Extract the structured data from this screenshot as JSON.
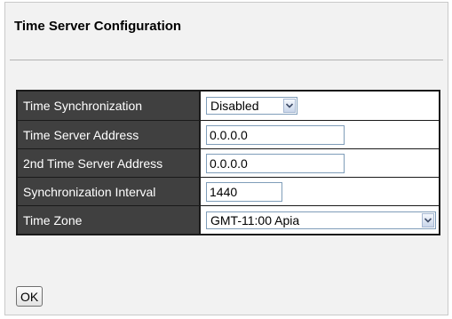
{
  "page": {
    "title": "Time Server Configuration"
  },
  "form": {
    "rows": [
      {
        "label": "Time Synchronization",
        "type": "select",
        "value": "Disabled"
      },
      {
        "label": "Time Server Address",
        "type": "text",
        "value": "0.0.0.0"
      },
      {
        "label": "2nd Time Server Address",
        "type": "text",
        "value": "0.0.0.0"
      },
      {
        "label": "Synchronization Interval",
        "type": "text",
        "value": "1440"
      },
      {
        "label": "Time Zone",
        "type": "select",
        "value": "GMT-11:00 Apia"
      }
    ]
  },
  "actions": {
    "ok_label": "OK"
  },
  "icons": {
    "dropdown": "chevron-down-icon"
  },
  "colors": {
    "label_cell_bg": "#404040",
    "label_text": "#ffffff",
    "panel_bg": "#f2f2f2",
    "table_border": "#1a1a1a",
    "input_border": "#7f9db9"
  }
}
